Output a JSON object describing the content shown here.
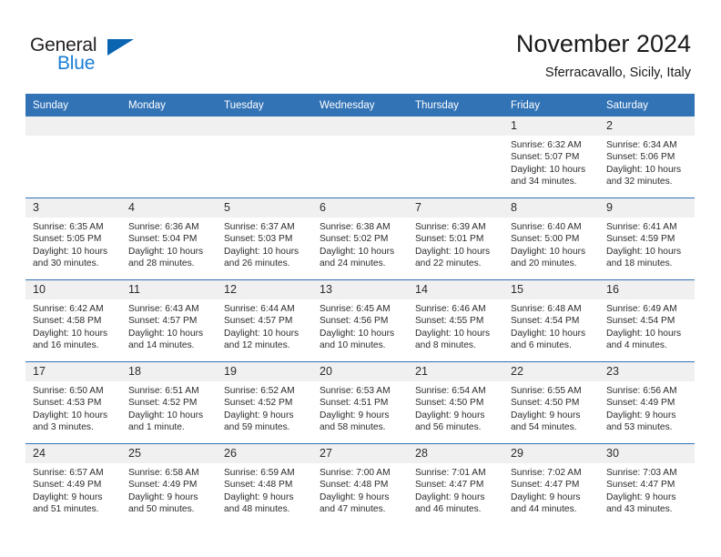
{
  "brand": {
    "name_part1": "General",
    "name_part2": "Blue",
    "triangle_icon": "triangle-icon",
    "accent_blue": "#1a7ed4",
    "triangle_blue": "#0a64b0"
  },
  "header": {
    "month_title": "November 2024",
    "location": "Sferracavallo, Sicily, Italy"
  },
  "calendar": {
    "header_color": "#3273b6",
    "daynum_band_color": "#f0f0f0",
    "weekday_headers": [
      "Sunday",
      "Monday",
      "Tuesday",
      "Wednesday",
      "Thursday",
      "Friday",
      "Saturday"
    ],
    "weeks": [
      [
        {
          "day": "",
          "blank": true,
          "sunrise": "",
          "sunset": "",
          "daylight_l1": "",
          "daylight_l2": ""
        },
        {
          "day": "",
          "blank": true,
          "sunrise": "",
          "sunset": "",
          "daylight_l1": "",
          "daylight_l2": ""
        },
        {
          "day": "",
          "blank": true,
          "sunrise": "",
          "sunset": "",
          "daylight_l1": "",
          "daylight_l2": ""
        },
        {
          "day": "",
          "blank": true,
          "sunrise": "",
          "sunset": "",
          "daylight_l1": "",
          "daylight_l2": ""
        },
        {
          "day": "",
          "blank": true,
          "sunrise": "",
          "sunset": "",
          "daylight_l1": "",
          "daylight_l2": ""
        },
        {
          "day": "1",
          "blank": false,
          "sunrise": "Sunrise: 6:32 AM",
          "sunset": "Sunset: 5:07 PM",
          "daylight_l1": "Daylight: 10 hours",
          "daylight_l2": "and 34 minutes."
        },
        {
          "day": "2",
          "blank": false,
          "sunrise": "Sunrise: 6:34 AM",
          "sunset": "Sunset: 5:06 PM",
          "daylight_l1": "Daylight: 10 hours",
          "daylight_l2": "and 32 minutes."
        }
      ],
      [
        {
          "day": "3",
          "blank": false,
          "sunrise": "Sunrise: 6:35 AM",
          "sunset": "Sunset: 5:05 PM",
          "daylight_l1": "Daylight: 10 hours",
          "daylight_l2": "and 30 minutes."
        },
        {
          "day": "4",
          "blank": false,
          "sunrise": "Sunrise: 6:36 AM",
          "sunset": "Sunset: 5:04 PM",
          "daylight_l1": "Daylight: 10 hours",
          "daylight_l2": "and 28 minutes."
        },
        {
          "day": "5",
          "blank": false,
          "sunrise": "Sunrise: 6:37 AM",
          "sunset": "Sunset: 5:03 PM",
          "daylight_l1": "Daylight: 10 hours",
          "daylight_l2": "and 26 minutes."
        },
        {
          "day": "6",
          "blank": false,
          "sunrise": "Sunrise: 6:38 AM",
          "sunset": "Sunset: 5:02 PM",
          "daylight_l1": "Daylight: 10 hours",
          "daylight_l2": "and 24 minutes."
        },
        {
          "day": "7",
          "blank": false,
          "sunrise": "Sunrise: 6:39 AM",
          "sunset": "Sunset: 5:01 PM",
          "daylight_l1": "Daylight: 10 hours",
          "daylight_l2": "and 22 minutes."
        },
        {
          "day": "8",
          "blank": false,
          "sunrise": "Sunrise: 6:40 AM",
          "sunset": "Sunset: 5:00 PM",
          "daylight_l1": "Daylight: 10 hours",
          "daylight_l2": "and 20 minutes."
        },
        {
          "day": "9",
          "blank": false,
          "sunrise": "Sunrise: 6:41 AM",
          "sunset": "Sunset: 4:59 PM",
          "daylight_l1": "Daylight: 10 hours",
          "daylight_l2": "and 18 minutes."
        }
      ],
      [
        {
          "day": "10",
          "blank": false,
          "sunrise": "Sunrise: 6:42 AM",
          "sunset": "Sunset: 4:58 PM",
          "daylight_l1": "Daylight: 10 hours",
          "daylight_l2": "and 16 minutes."
        },
        {
          "day": "11",
          "blank": false,
          "sunrise": "Sunrise: 6:43 AM",
          "sunset": "Sunset: 4:57 PM",
          "daylight_l1": "Daylight: 10 hours",
          "daylight_l2": "and 14 minutes."
        },
        {
          "day": "12",
          "blank": false,
          "sunrise": "Sunrise: 6:44 AM",
          "sunset": "Sunset: 4:57 PM",
          "daylight_l1": "Daylight: 10 hours",
          "daylight_l2": "and 12 minutes."
        },
        {
          "day": "13",
          "blank": false,
          "sunrise": "Sunrise: 6:45 AM",
          "sunset": "Sunset: 4:56 PM",
          "daylight_l1": "Daylight: 10 hours",
          "daylight_l2": "and 10 minutes."
        },
        {
          "day": "14",
          "blank": false,
          "sunrise": "Sunrise: 6:46 AM",
          "sunset": "Sunset: 4:55 PM",
          "daylight_l1": "Daylight: 10 hours",
          "daylight_l2": "and 8 minutes."
        },
        {
          "day": "15",
          "blank": false,
          "sunrise": "Sunrise: 6:48 AM",
          "sunset": "Sunset: 4:54 PM",
          "daylight_l1": "Daylight: 10 hours",
          "daylight_l2": "and 6 minutes."
        },
        {
          "day": "16",
          "blank": false,
          "sunrise": "Sunrise: 6:49 AM",
          "sunset": "Sunset: 4:54 PM",
          "daylight_l1": "Daylight: 10 hours",
          "daylight_l2": "and 4 minutes."
        }
      ],
      [
        {
          "day": "17",
          "blank": false,
          "sunrise": "Sunrise: 6:50 AM",
          "sunset": "Sunset: 4:53 PM",
          "daylight_l1": "Daylight: 10 hours",
          "daylight_l2": "and 3 minutes."
        },
        {
          "day": "18",
          "blank": false,
          "sunrise": "Sunrise: 6:51 AM",
          "sunset": "Sunset: 4:52 PM",
          "daylight_l1": "Daylight: 10 hours",
          "daylight_l2": "and 1 minute."
        },
        {
          "day": "19",
          "blank": false,
          "sunrise": "Sunrise: 6:52 AM",
          "sunset": "Sunset: 4:52 PM",
          "daylight_l1": "Daylight: 9 hours",
          "daylight_l2": "and 59 minutes."
        },
        {
          "day": "20",
          "blank": false,
          "sunrise": "Sunrise: 6:53 AM",
          "sunset": "Sunset: 4:51 PM",
          "daylight_l1": "Daylight: 9 hours",
          "daylight_l2": "and 58 minutes."
        },
        {
          "day": "21",
          "blank": false,
          "sunrise": "Sunrise: 6:54 AM",
          "sunset": "Sunset: 4:50 PM",
          "daylight_l1": "Daylight: 9 hours",
          "daylight_l2": "and 56 minutes."
        },
        {
          "day": "22",
          "blank": false,
          "sunrise": "Sunrise: 6:55 AM",
          "sunset": "Sunset: 4:50 PM",
          "daylight_l1": "Daylight: 9 hours",
          "daylight_l2": "and 54 minutes."
        },
        {
          "day": "23",
          "blank": false,
          "sunrise": "Sunrise: 6:56 AM",
          "sunset": "Sunset: 4:49 PM",
          "daylight_l1": "Daylight: 9 hours",
          "daylight_l2": "and 53 minutes."
        }
      ],
      [
        {
          "day": "24",
          "blank": false,
          "sunrise": "Sunrise: 6:57 AM",
          "sunset": "Sunset: 4:49 PM",
          "daylight_l1": "Daylight: 9 hours",
          "daylight_l2": "and 51 minutes."
        },
        {
          "day": "25",
          "blank": false,
          "sunrise": "Sunrise: 6:58 AM",
          "sunset": "Sunset: 4:49 PM",
          "daylight_l1": "Daylight: 9 hours",
          "daylight_l2": "and 50 minutes."
        },
        {
          "day": "26",
          "blank": false,
          "sunrise": "Sunrise: 6:59 AM",
          "sunset": "Sunset: 4:48 PM",
          "daylight_l1": "Daylight: 9 hours",
          "daylight_l2": "and 48 minutes."
        },
        {
          "day": "27",
          "blank": false,
          "sunrise": "Sunrise: 7:00 AM",
          "sunset": "Sunset: 4:48 PM",
          "daylight_l1": "Daylight: 9 hours",
          "daylight_l2": "and 47 minutes."
        },
        {
          "day": "28",
          "blank": false,
          "sunrise": "Sunrise: 7:01 AM",
          "sunset": "Sunset: 4:47 PM",
          "daylight_l1": "Daylight: 9 hours",
          "daylight_l2": "and 46 minutes."
        },
        {
          "day": "29",
          "blank": false,
          "sunrise": "Sunrise: 7:02 AM",
          "sunset": "Sunset: 4:47 PM",
          "daylight_l1": "Daylight: 9 hours",
          "daylight_l2": "and 44 minutes."
        },
        {
          "day": "30",
          "blank": false,
          "sunrise": "Sunrise: 7:03 AM",
          "sunset": "Sunset: 4:47 PM",
          "daylight_l1": "Daylight: 9 hours",
          "daylight_l2": "and 43 minutes."
        }
      ]
    ]
  }
}
